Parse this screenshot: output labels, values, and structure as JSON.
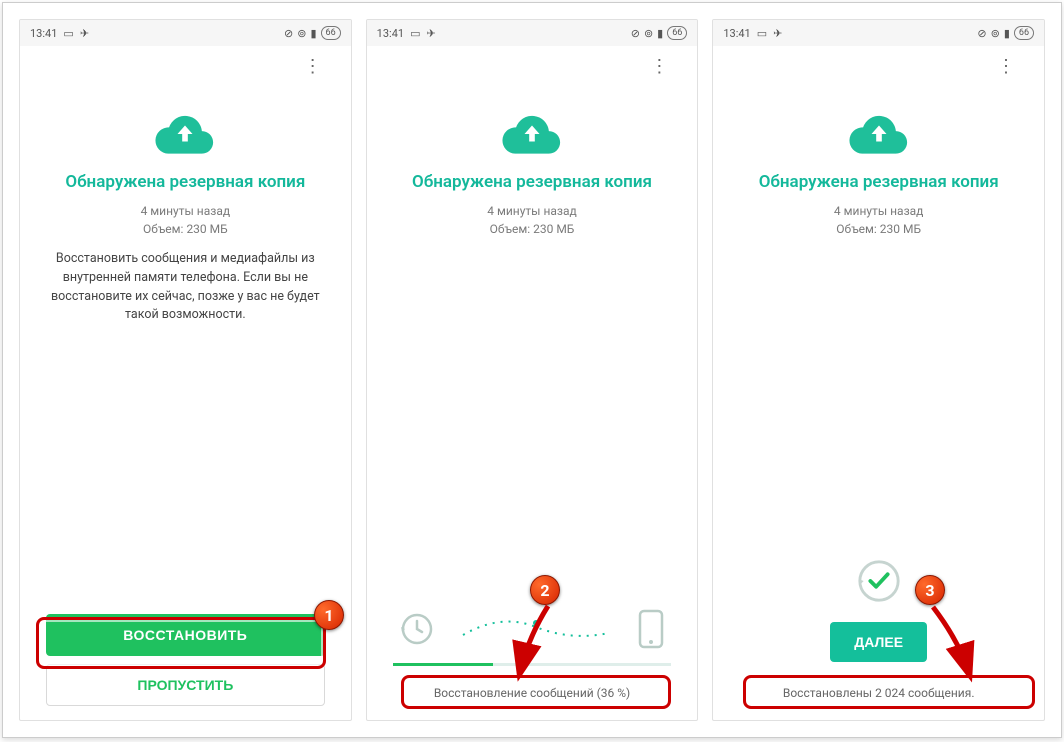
{
  "status": {
    "time": "13:41",
    "battery": "66"
  },
  "common": {
    "heading": "Обнаружена резервная копия",
    "meta_time": "4 минуты назад",
    "meta_size": "Объем: 230 МБ"
  },
  "screen1": {
    "description": "Восстановить сообщения и медиафайлы из внутренней памяти телефона. Если вы не восстановите их сейчас, позже у вас не будет такой возможности.",
    "restore_label": "ВОССТАНОВИТЬ",
    "skip_label": "ПРОПУСТИТЬ"
  },
  "screen2": {
    "progress_text": "Восстановление сообщений (36 %)",
    "progress_pct": 36
  },
  "screen3": {
    "next_label": "ДАЛЕЕ",
    "done_text": "Восстановлены 2 024 сообщения."
  },
  "annotations": {
    "badge1": "1",
    "badge2": "2",
    "badge3": "3"
  }
}
